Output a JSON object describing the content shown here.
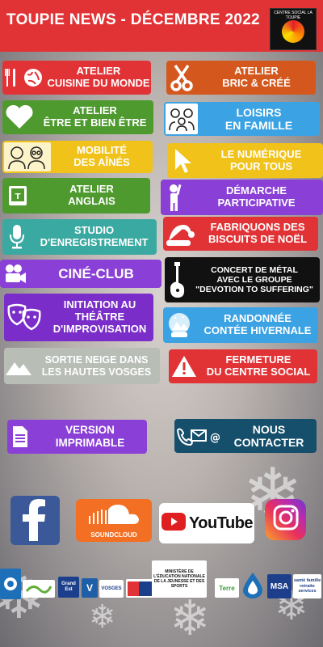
{
  "header": {
    "title": "TOUPIE NEWS - DÉCEMBRE 2022",
    "logo_text": "CENTRE SOCIAL LA TOUPIE"
  },
  "buttons": {
    "cuisine": "ATELIER\nCUISINE DU MONDE",
    "bric": "ATELIER\nBRIC & CRÉÉ",
    "etre": "ATELIER\nÊTRE ET BIEN ÊTRE",
    "loisirs": "LOISIRS\nEN FAMILLE",
    "mobilite": "MOBILITÉ\nDES AÎNÉS",
    "numerique": "LE NUMÉRIQUE\nPOUR TOUS",
    "anglais": "ATELIER\nANGLAIS",
    "demarche": "DÉMARCHE\nPARTICIPATIVE",
    "studio": "STUDIO\nD'ENREGISTREMENT",
    "biscuits": "FABRIQUONS DES\nBISCUITS DE NOËL",
    "cine": "CINÉ-CLUB",
    "concert": "CONCERT DE MÉTAL\nAVEC LE GROUPE\n\"DEVOTION TO SUFFERING\"",
    "theatre": "INITIATION AU\nTHÉÂTRE\nD'IMPROVISATION",
    "randonnee": "RANDONNÉE\nCONTÉE HIVERNALE",
    "neige": "SORTIE NEIGE DANS\nLES HAUTES VOSGES",
    "fermeture": "FERMETURE\nDU CENTRE SOCIAL",
    "version": "VERSION\nIMPRIMABLE",
    "contact": "NOUS\nCONTACTER"
  },
  "social": {
    "soundcloud": "SOUNDCLOUD",
    "youtube": "YouTube"
  },
  "partners": [
    "MINISTÈRE DE L'ÉDUCATION NATIONALE DE LA JEUNESSE ET DES SPORTS",
    "Grand Est",
    "VOSGES",
    "Terre",
    "santé famille retraite services"
  ],
  "colors": {
    "header": "#e13336",
    "red": "#e13336",
    "orange": "#d4571d",
    "green": "#4e9a2f",
    "blue": "#3ba2e3",
    "yellow": "#f0c21a",
    "violet": "#8a3fd6",
    "teal": "#3aa9a1",
    "purple_dark": "#7a2dc9",
    "black": "#111111",
    "grey": "#b8bdb6",
    "navy": "#164f6b"
  }
}
